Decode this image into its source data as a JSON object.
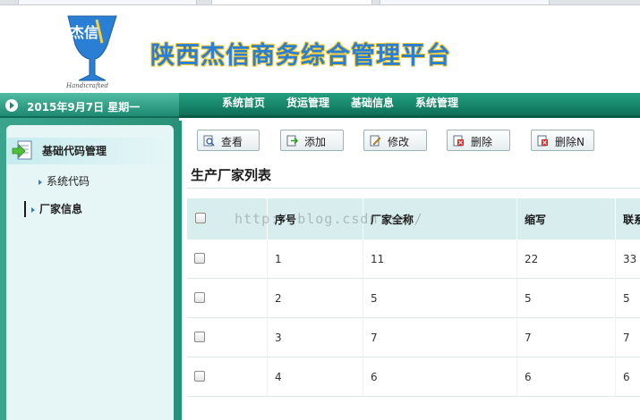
{
  "header": {
    "logo_text": "杰信",
    "logo_subtext": "Handicrafted",
    "site_title": "陕西杰信商务综合管理平台"
  },
  "date_bar": {
    "date_text": "2015年9月7日 星期一"
  },
  "top_nav": {
    "items": [
      {
        "label": "系统首页"
      },
      {
        "label": "货运管理"
      },
      {
        "label": "基础信息"
      },
      {
        "label": "系统管理"
      }
    ]
  },
  "sidebar": {
    "group_label": "基础代码管理",
    "items": [
      {
        "label": "系统代码"
      },
      {
        "label": "厂家信息"
      }
    ]
  },
  "toolbar": {
    "buttons": [
      {
        "label": "查看",
        "icon": "view-icon"
      },
      {
        "label": "添加",
        "icon": "add-icon"
      },
      {
        "label": "修改",
        "icon": "edit-icon"
      },
      {
        "label": "删除",
        "icon": "delete-icon"
      },
      {
        "label": "删除N",
        "icon": "delete-many-icon"
      }
    ]
  },
  "list": {
    "title": "生产厂家列表",
    "columns": [
      "序号",
      "厂家全称",
      "缩写",
      "联系"
    ],
    "rows": [
      {
        "index": "1",
        "full_name": "11",
        "abbr": "22",
        "contact": "33"
      },
      {
        "index": "2",
        "full_name": "5",
        "abbr": "5",
        "contact": "5"
      },
      {
        "index": "3",
        "full_name": "7",
        "abbr": "7",
        "contact": "7"
      },
      {
        "index": "4",
        "full_name": "6",
        "abbr": "6",
        "contact": "6"
      }
    ]
  },
  "watermark": "http://blog.csdn.net/",
  "colors": {
    "accent_green": "#1e8a72",
    "title_blue": "#2a7fd4",
    "title_gold": "#f7cf3a",
    "header_row_bg": "#d8eeee",
    "sidebar_panel_bg": "#e6f6f7"
  }
}
